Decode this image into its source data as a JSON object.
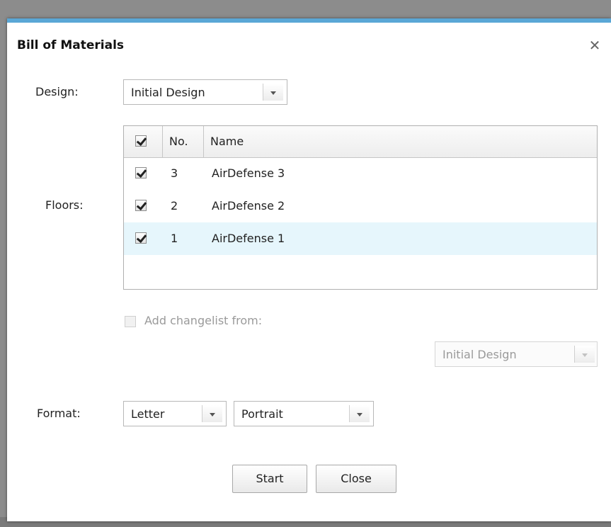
{
  "dialog": {
    "title": "Bill of Materials",
    "close_icon": "close-icon"
  },
  "design": {
    "label": "Design:",
    "selected": "Initial Design"
  },
  "floors": {
    "label": "Floors:",
    "columns": [
      "No.",
      "Name"
    ],
    "header_checked": true,
    "rows": [
      {
        "no": "3",
        "name": "AirDefense 3",
        "checked": true,
        "selected": false
      },
      {
        "no": "2",
        "name": "AirDefense 2",
        "checked": true,
        "selected": false
      },
      {
        "no": "1",
        "name": "AirDefense 1",
        "checked": true,
        "selected": true
      }
    ]
  },
  "changelist": {
    "label": "Add changelist from:",
    "checked": false,
    "enabled": false,
    "selected": "Initial Design"
  },
  "format": {
    "label": "Format:",
    "paper": "Letter",
    "orientation": "Portrait"
  },
  "buttons": {
    "start": "Start",
    "close": "Close"
  },
  "colors": {
    "accent": "#5aa7d6",
    "selected_row": "#e6f6fc"
  }
}
